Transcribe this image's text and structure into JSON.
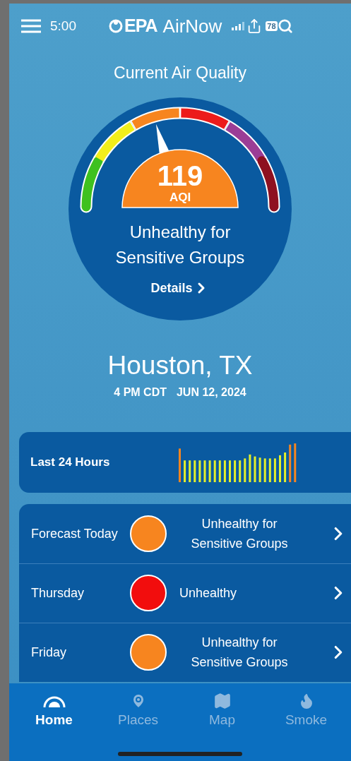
{
  "status_bar": {
    "time": "5:00",
    "brand": "EPA",
    "app_name": "AirNow",
    "battery": "78"
  },
  "title": "Current Air Quality",
  "gauge": {
    "value": "119",
    "unit": "AQI",
    "level": 0.41,
    "color": "#f7851f",
    "category": "Unhealthy for Sensitive Groups",
    "link": "Details"
  },
  "location": {
    "city": "Houston, TX",
    "time": "4 PM CDT",
    "date": "JUN 12, 2024"
  },
  "history": {
    "label": "Last 24 Hours"
  },
  "forecast": [
    {
      "label": "Forecast Today",
      "category": "Unhealthy for Sensitive Groups",
      "color": "#f7851f"
    },
    {
      "label": "Thursday",
      "category": "Unhealthy",
      "color": "#f20d0d"
    },
    {
      "label": "Friday",
      "category": "Unhealthy for Sensitive Groups",
      "color": "#f7851f"
    }
  ],
  "tabs": [
    {
      "label": "Home",
      "selected": true
    },
    {
      "label": "Places",
      "selected": false
    },
    {
      "label": "Map",
      "selected": false
    },
    {
      "label": "Smoke",
      "selected": false
    }
  ]
}
